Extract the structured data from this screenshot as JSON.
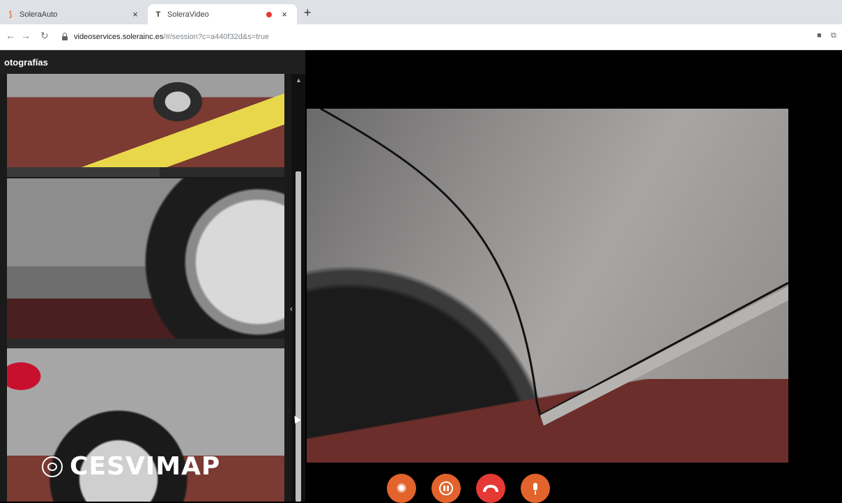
{
  "browser": {
    "tabs": [
      {
        "title": "SoleraAuto",
        "favicon": "solera-flame-icon",
        "close": "×"
      },
      {
        "title": "SoleraVideo",
        "favicon": "solera-t-icon",
        "close": "×",
        "recording": true
      }
    ],
    "new_tab": "+",
    "url_host": "videoservices.solerainc.es",
    "url_path": "/#/session?c=a440f32d&s=true"
  },
  "app": {
    "panel_title": "otografías",
    "thumbnails": [
      {
        "label": "car-wheel-on-yellow-platform"
      },
      {
        "label": "rear-bumper-dent-closeup"
      },
      {
        "label": "car-side-rear-door"
      }
    ],
    "thumbnail_progress": [
      0.55
    ],
    "watermark": "CESVIMAP"
  },
  "controls": [
    {
      "name": "camera-shutter-button",
      "icon": "shutter-icon",
      "color": "#e2632b"
    },
    {
      "name": "pause-button",
      "icon": "pause-icon",
      "color": "#e2632b"
    },
    {
      "name": "hang-up-button",
      "icon": "phone-hangup-icon",
      "color": "#e53935"
    },
    {
      "name": "microphone-button",
      "icon": "microphone-icon",
      "color": "#e2632b"
    }
  ]
}
